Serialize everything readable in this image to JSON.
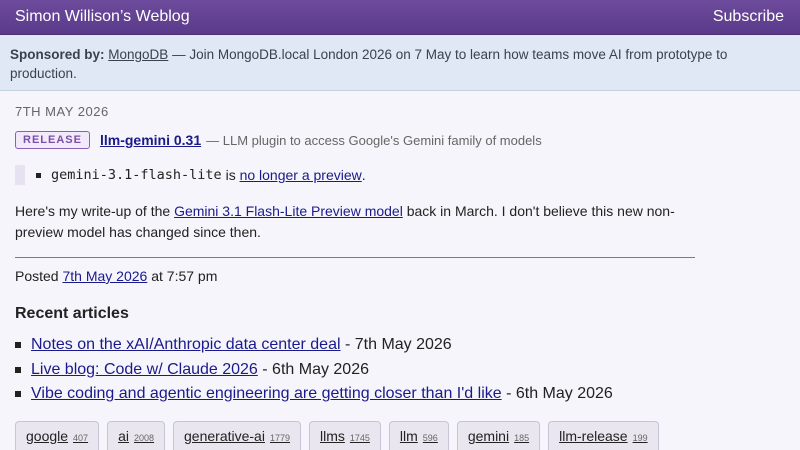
{
  "header": {
    "site_title": "Simon Willison’s Weblog",
    "subscribe": "Subscribe"
  },
  "sponsor": {
    "label": "Sponsored by:",
    "sponsor_name": "MongoDB",
    "message": " — Join MongoDB.local London 2026 on 7 May to learn how teams move AI from prototype to production."
  },
  "entry": {
    "date": "7TH MAY 2026",
    "badge": "RELEASE",
    "title": "llm-gemini 0.31",
    "description": "— LLM plugin to access Google's Gemini family of models",
    "bullet": {
      "code": "gemini-3.1-flash-lite",
      "middle": " is ",
      "link": "no longer a preview",
      "end": "."
    },
    "writeup": {
      "before": "Here's my write-up of the ",
      "link": "Gemini 3.1 Flash-Lite Preview model",
      "after": " back in March. I don't believe this new non-preview model has changed since then."
    },
    "posted": {
      "prefix": "Posted ",
      "date_link": "7th May 2026",
      "time": " at 7:57 pm"
    }
  },
  "recent": {
    "heading": "Recent articles",
    "items": [
      {
        "title": "Notes on the xAI/Anthropic data center deal",
        "date": " - 7th May 2026"
      },
      {
        "title": "Live blog: Code w/ Claude 2026",
        "date": " - 6th May 2026"
      },
      {
        "title": "Vibe coding and agentic engineering are getting closer than I'd like",
        "date": " - 6th May 2026"
      }
    ]
  },
  "tags": [
    {
      "name": "google",
      "count": "407"
    },
    {
      "name": "ai",
      "count": "2008"
    },
    {
      "name": "generative-ai",
      "count": "1779"
    },
    {
      "name": "llms",
      "count": "1745"
    },
    {
      "name": "llm",
      "count": "596"
    },
    {
      "name": "gemini",
      "count": "185"
    },
    {
      "name": "llm-release",
      "count": "199"
    }
  ]
}
